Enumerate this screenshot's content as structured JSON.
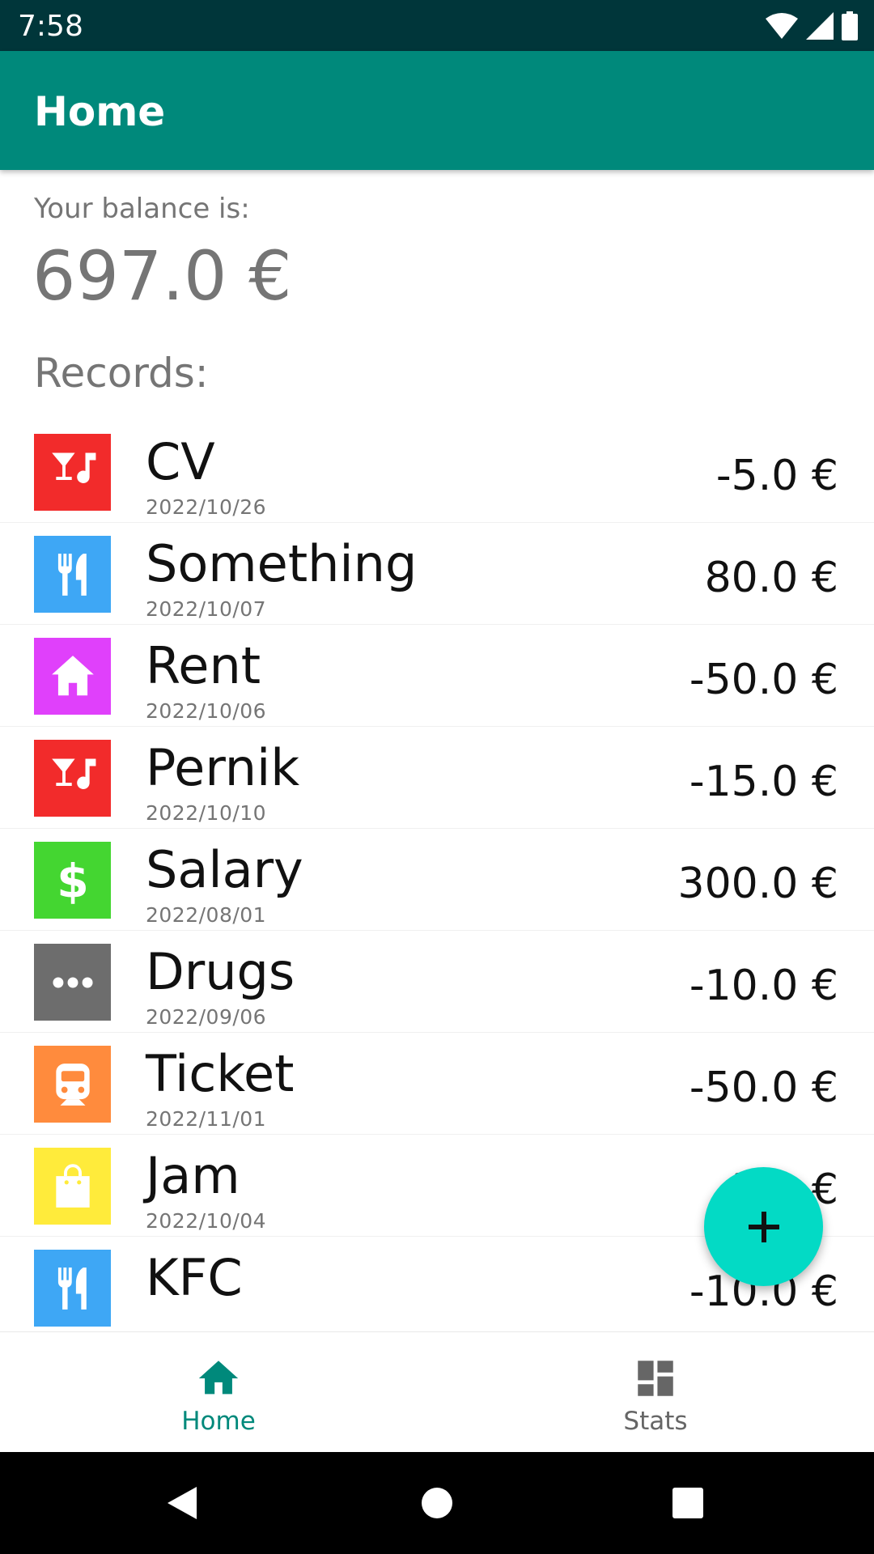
{
  "status_bar": {
    "time": "7:58"
  },
  "app_bar": {
    "title": "Home"
  },
  "balance": {
    "label": "Your balance is:",
    "value": "697.0 €"
  },
  "records_label": "Records:",
  "records": [
    {
      "name": "CV",
      "date": "2022/10/26",
      "amount": "-5.0  €",
      "icon": "nightlife-icon",
      "color": "#f22b2b"
    },
    {
      "name": "Something",
      "date": "2022/10/07",
      "amount": "80.0  €",
      "icon": "restaurant-icon",
      "color": "#3ea7f5"
    },
    {
      "name": "Rent",
      "date": "2022/10/06",
      "amount": "-50.0  €",
      "icon": "house-icon",
      "color": "#e040fb"
    },
    {
      "name": "Pernik",
      "date": "2022/10/10",
      "amount": "-15.0  €",
      "icon": "nightlife-icon",
      "color": "#f22b2b"
    },
    {
      "name": "Salary",
      "date": "2022/08/01",
      "amount": "300.0  €",
      "icon": "dollar-icon",
      "color": "#44d631"
    },
    {
      "name": "Drugs",
      "date": "2022/09/06",
      "amount": "-10.0  €",
      "icon": "more-horiz-icon",
      "color": "#6d6d6d"
    },
    {
      "name": "Ticket",
      "date": "2022/11/01",
      "amount": "-50.0  €",
      "icon": "train-icon",
      "color": "#ff8b3d"
    },
    {
      "name": "Jam",
      "date": "2022/10/04",
      "amount": "-3.0  €",
      "icon": "shopping-bag-icon",
      "color": "#ffeb3b"
    },
    {
      "name": "KFC",
      "date": "",
      "amount": "-10.0  €",
      "icon": "restaurant-icon",
      "color": "#3ea7f5"
    }
  ],
  "fab": {
    "icon": "plus-icon"
  },
  "bottom_nav": {
    "items": [
      {
        "label": "Home",
        "icon": "home-icon",
        "selected": true
      },
      {
        "label": "Stats",
        "icon": "dashboard-icon",
        "selected": false
      }
    ]
  },
  "colors": {
    "status_bar": "#00363a",
    "app_bar": "#00897b",
    "fab": "#03dac5",
    "accent": "#00897b"
  }
}
